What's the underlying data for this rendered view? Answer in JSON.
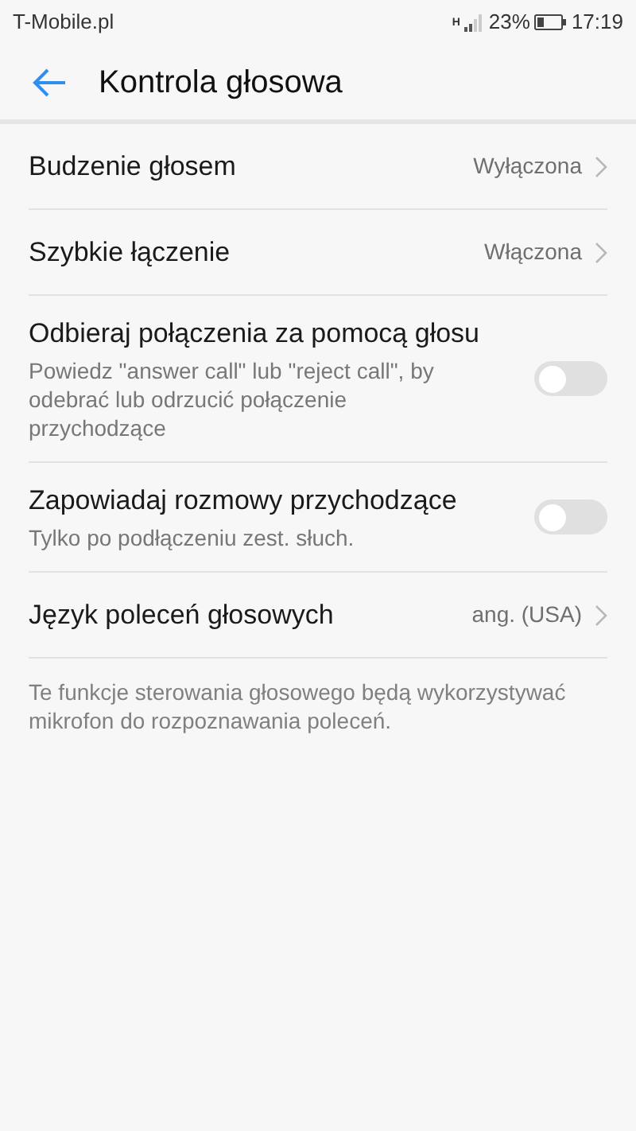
{
  "status_bar": {
    "carrier": "T-Mobile.pl",
    "network": "H",
    "battery": "23%",
    "time": "17:19"
  },
  "header": {
    "title": "Kontrola głosowa"
  },
  "settings": [
    {
      "kind": "link",
      "title": "Budzenie głosem",
      "value": "Wyłączona"
    },
    {
      "kind": "link",
      "title": "Szybkie łączenie",
      "value": "Włączona"
    },
    {
      "kind": "toggle",
      "title": "Odbieraj połączenia za pomocą głosu",
      "subtitle": "Powiedz \"answer call\" lub \"reject call\", by odebrać lub odrzucić połączenie przychodzące",
      "on": false
    },
    {
      "kind": "toggle",
      "title": "Zapowiadaj rozmowy przychodzące",
      "subtitle": "Tylko po podłączeniu zest. słuch.",
      "on": false
    },
    {
      "kind": "link",
      "title": "Język poleceń głosowych",
      "value": "ang. (USA)"
    }
  ],
  "footer": "Te funkcje sterowania głosowego będą wykorzystywać mikrofon do rozpoznawania poleceń."
}
